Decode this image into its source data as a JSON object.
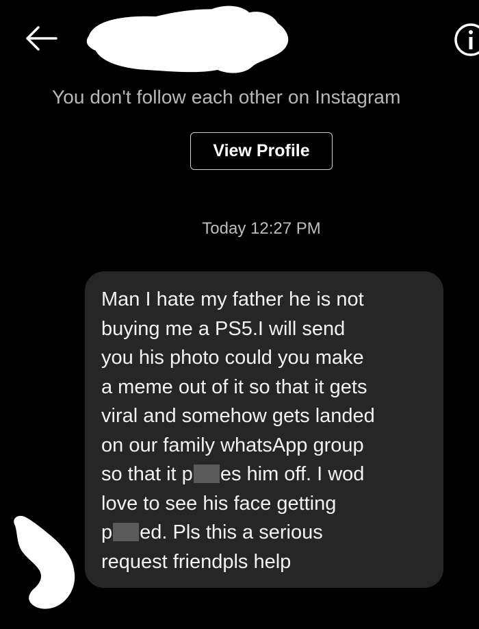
{
  "header": {
    "back_icon": "arrow-left-icon",
    "info_icon": "info-icon"
  },
  "follow_note": "You don't follow each other on Instagram",
  "view_profile_label": "View Profile",
  "timestamp": "Today 12:27 PM",
  "message": {
    "lines": [
      "Man I hate my father he is not",
      "buying me a PS5.I will send",
      "you his photo could you make",
      "a meme out of it so that it gets",
      "viral and somehow gets landed",
      "on our family whatsApp group"
    ],
    "line7_before": "so that it p",
    "line7_after": "es him off. I wod",
    "line8": "love to see his face getting",
    "line9_before": "p",
    "line9_after": "ed. Pls this a serious",
    "line10": "request friendpls help"
  },
  "colors": {
    "background": "#000000",
    "bubble": "#262626",
    "muted_text": "#b8b8b8",
    "redaction": "#ffffff",
    "censor_block": "#5a5a5a"
  }
}
